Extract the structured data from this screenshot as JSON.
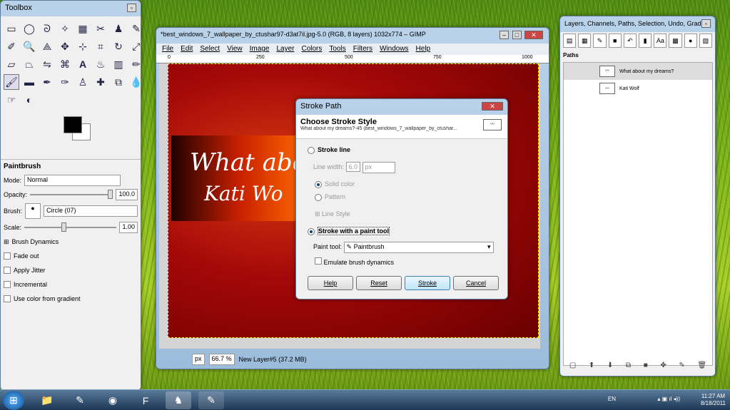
{
  "toolbox": {
    "title": "Toolbox",
    "options_title": "Paintbrush",
    "mode_label": "Mode:",
    "mode_value": "Normal",
    "opacity_label": "Opacity:",
    "opacity_value": "100.0",
    "brush_label": "Brush:",
    "brush_value": "Circle (07)",
    "scale_label": "Scale:",
    "scale_value": "1.00",
    "brush_dynamics": "Brush Dynamics",
    "fade_out": "Fade out",
    "apply_jitter": "Apply Jitter",
    "incremental": "Incremental",
    "use_gradient": "Use color from gradient"
  },
  "gimp": {
    "title": "*best_windows_7_wallpaper_by_ctushar97-d3at7il.jpg-5.0 (RGB, 8 layers) 1032x774 – GIMP",
    "menu": [
      "File",
      "Edit",
      "Select",
      "View",
      "Image",
      "Layer",
      "Colors",
      "Tools",
      "Filters",
      "Windows",
      "Help"
    ],
    "ruler_ticks": [
      "0",
      "250",
      "500",
      "750",
      "1000"
    ],
    "canvas_text1": "What about",
    "canvas_text2": "Kati Wo",
    "unit": "px",
    "zoom": "66.7 %",
    "layer_status": "New Layer#5 (37.2 MB)"
  },
  "dialog": {
    "title": "Stroke Path",
    "heading": "Choose Stroke Style",
    "subtitle": "What about my dreams?-45 (best_windows_7_wallpaper_by_ctushar...",
    "stroke_line": "Stroke line",
    "line_width_label": "Line width:",
    "line_width_value": "6.0",
    "line_unit": "px",
    "solid_color": "Solid color",
    "pattern": "Pattern",
    "line_style": "Line Style",
    "stroke_paint": "Stroke with a paint tool",
    "paint_tool_label": "Paint tool:",
    "paint_tool_value": "Paintbrush",
    "emulate": "Emulate brush dynamics",
    "help": "Help",
    "reset": "Reset",
    "stroke": "Stroke",
    "cancel": "Cancel"
  },
  "layers": {
    "title": "Layers, Channels, Paths, Selection, Undo, Gradie...",
    "paths_label": "Paths",
    "paths": [
      {
        "name": "What about my dreams?"
      },
      {
        "name": "Kati Wolf"
      }
    ]
  },
  "taskbar": {
    "lang": "EN",
    "time": "11:27 AM",
    "date": "8/18/2011"
  }
}
